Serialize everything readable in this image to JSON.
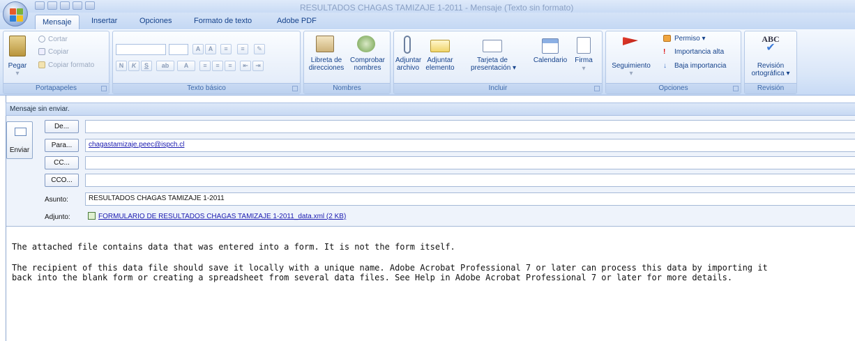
{
  "window": {
    "title": "RESULTADOS CHAGAS TAMIZAJE 1-2011 - Mensaje (Texto sin formato)"
  },
  "tabs": [
    {
      "label": "Mensaje",
      "active": true
    },
    {
      "label": "Insertar"
    },
    {
      "label": "Opciones"
    },
    {
      "label": "Formato de texto"
    },
    {
      "label": "Adobe PDF"
    }
  ],
  "ribbon": {
    "portapapeles": {
      "label": "Portapapeles",
      "pegar": "Pegar",
      "cortar": "Cortar",
      "copiar": "Copiar",
      "copiar_formato": "Copiar formato"
    },
    "texto_basico": {
      "label": "Texto básico",
      "bold": "N",
      "italic": "K",
      "underline": "S"
    },
    "nombres": {
      "label": "Nombres",
      "libreta": [
        "Libreta de",
        "direcciones"
      ],
      "comprobar": [
        "Comprobar",
        "nombres"
      ]
    },
    "incluir": {
      "label": "Incluir",
      "adjuntar_archivo": [
        "Adjuntar",
        "archivo"
      ],
      "adjuntar_elemento": [
        "Adjuntar",
        "elemento"
      ],
      "tarjeta": [
        "Tarjeta de",
        "presentación ▾"
      ],
      "calendario": "Calendario",
      "firma": "Firma"
    },
    "opciones": {
      "label": "Opciones",
      "seguimiento": "Seguimiento",
      "permiso": "Permiso ▾",
      "importancia_alta": "Importancia alta",
      "baja_importancia": "Baja importancia"
    },
    "revision": {
      "label": "Revisión",
      "abc": "ABC",
      "revision_ortografica": [
        "Revisión",
        "ortográfica ▾"
      ]
    }
  },
  "infobar": {
    "text": "Mensaje sin enviar."
  },
  "send": {
    "label": "Enviar"
  },
  "fields": {
    "de": {
      "button": "De...",
      "value": ""
    },
    "para": {
      "button": "Para...",
      "value": "chagastamizaje.peec@ispch.cl"
    },
    "cc": {
      "button": "CC...",
      "value": ""
    },
    "cco": {
      "button": "CCO...",
      "value": ""
    },
    "asunto": {
      "label": "Asunto:",
      "value": "RESULTADOS CHAGAS TAMIZAJE 1-2011"
    },
    "adjunto": {
      "label": "Adjunto:",
      "value": "FORMULARIO DE RESULTADOS CHAGAS TAMIZAJE 1-2011_data.xml (2 KB)"
    }
  },
  "body": {
    "line1": "The attached file contains data that was entered into a form. It is not the form itself.",
    "line2": "The recipient of this data file should save it locally with a unique name. Adobe Acrobat Professional 7 or later can process this data by importing it",
    "line3": "back into the blank form or creating a spreadsheet from several data files. See Help in Adobe Acrobat Professional 7 or later for more details."
  }
}
